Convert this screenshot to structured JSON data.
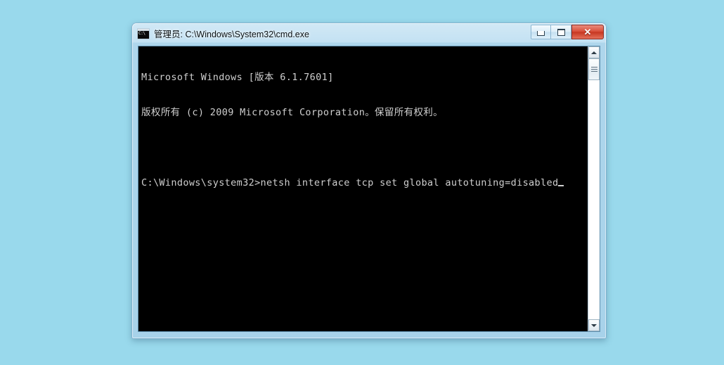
{
  "desktop": {
    "background_color": "#99d9ec"
  },
  "window": {
    "title": "管理员: C:\\Windows\\System32\\cmd.exe",
    "icon": "cmd-console-icon",
    "icon_text": "C:\\",
    "accent_close_color": "#c73722",
    "frame_color": "#a8d2ea",
    "controls": {
      "minimize_label": "最小化",
      "maximize_label": "最大化",
      "close_label": "关闭",
      "close_glyph": "✕"
    }
  },
  "console": {
    "background_color": "#000000",
    "text_color": "#cfcfcf",
    "lines": [
      "Microsoft Windows [版本 6.1.7601]",
      "版权所有 (c) 2009 Microsoft Corporation。保留所有权利。",
      "",
      "C:\\Windows\\system32>netsh interface tcp set global autotuning=disabled"
    ],
    "prompt": "C:\\Windows\\system32>",
    "command": "netsh interface tcp set global autotuning=disabled",
    "cursor": "_"
  },
  "scrollbar": {
    "up_arrow": "▲",
    "down_arrow": "▼",
    "thumb_position": "top"
  }
}
